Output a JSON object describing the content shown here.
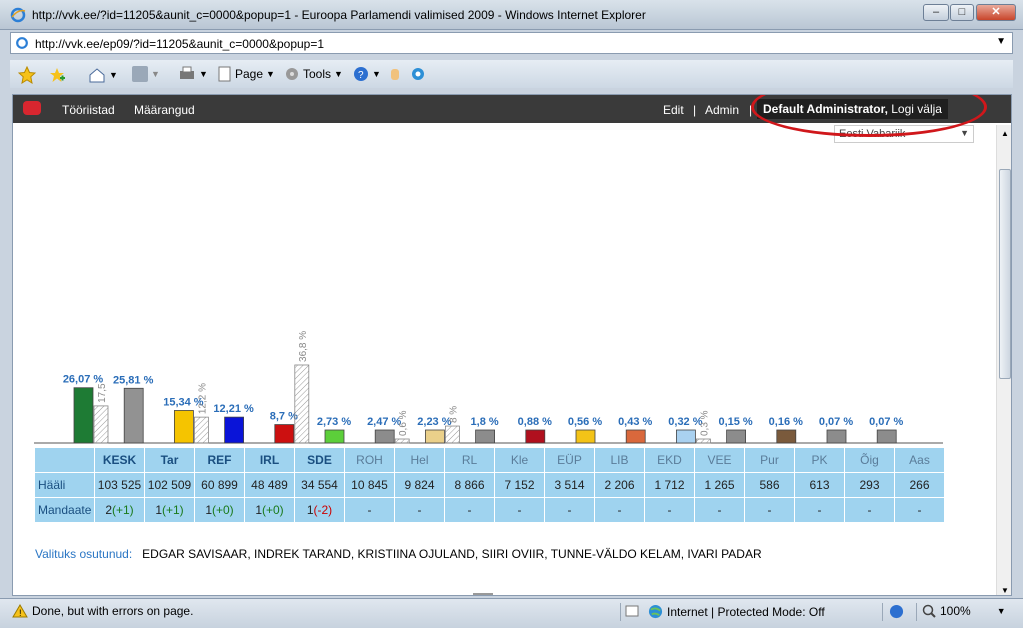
{
  "window": {
    "title": "http://vvk.ee/?id=11205&aunit_c=0000&popup=1 - Euroopa Parlamendi valimised 2009 - Windows Internet Explorer",
    "url": "http://vvk.ee/ep09/?id=11205&aunit_c=0000&popup=1",
    "min": "–",
    "max": "□",
    "close": "✕"
  },
  "commandbar": {
    "page": "Page",
    "tools": "Tools"
  },
  "nav": {
    "tooriistad": "Tööriistad",
    "maarangud": "Määrangud",
    "edit": "Edit",
    "sep": "|",
    "admin": "Admin",
    "user": "Default Administrator,",
    "logout": "Logi välja",
    "select_value": "Eesti Vabariik"
  },
  "chart_data": {
    "type": "bar",
    "categories": [
      "KESK",
      "Tar",
      "REF",
      "IRL",
      "SDE",
      "ROH",
      "Hel",
      "RL",
      "Kle",
      "EÜP",
      "LIB",
      "EKD",
      "VEE",
      "Pur",
      "PK",
      "Õig",
      "Aas"
    ],
    "series": [
      {
        "values": [
          26.07,
          25.81,
          15.34,
          12.21,
          8.7,
          2.73,
          2.47,
          2.23,
          1.8,
          0.88,
          0.56,
          0.43,
          0.32,
          0.15,
          0.16,
          0.07,
          0.07
        ],
        "labels": [
          "26,07 %",
          "25,81 %",
          "15,34 %",
          "12,21 %",
          "8,7 %",
          "2,73 %",
          "2,47 %",
          "2,23 %",
          "1,8 %",
          "0,88 %",
          "0,56 %",
          "0,43 %",
          "0,32 %",
          "0,15 %",
          "0,16 %",
          "0,07 %",
          "0,07 %"
        ]
      },
      {
        "values": [
          17.5,
          null,
          12.2,
          null,
          36.8,
          null,
          0.6,
          8,
          null,
          null,
          null,
          null,
          0.3,
          null,
          null,
          null,
          null
        ],
        "labels": [
          "17,5",
          "",
          "12,2 %",
          "",
          "36,8 %",
          "",
          "0,6 %",
          "8 %",
          "",
          "",
          "",
          "",
          "0,3 %",
          "",
          "",
          "",
          ""
        ]
      }
    ],
    "colors": [
      "#1e7b34",
      "#929292",
      "#f5c400",
      "#0a14d8",
      "#cc1010",
      "#5ccf3a",
      "#8c8c8c",
      "#ead08a",
      "#8c8c8c",
      "#b0101e",
      "#f3c317",
      "#d9683c",
      "#a9d1f0",
      "#8c8c8c",
      "#7a5a3c",
      "#8c8c8c",
      "#8c8c8c"
    ],
    "ylim": [
      0,
      40
    ]
  },
  "table": {
    "row_votes_label": "Hääli",
    "row_seats_label": "Mandaate",
    "headers": [
      "KESK",
      "Tar",
      "REF",
      "IRL",
      "SDE",
      "ROH",
      "Hel",
      "RL",
      "Kle",
      "EÜP",
      "LIB",
      "EKD",
      "VEE",
      "Pur",
      "PK",
      "Õig",
      "Aas"
    ],
    "votes": [
      "103 525",
      "102 509",
      "60 899",
      "48 489",
      "34 554",
      "10 845",
      "9 824",
      "8 866",
      "7 152",
      "3 514",
      "2 206",
      "1 712",
      "1 265",
      "586",
      "613",
      "293",
      "266"
    ],
    "seats_main": [
      "2",
      "1",
      "1",
      "1",
      "1",
      "-",
      "-",
      "-",
      "-",
      "-",
      "-",
      "-",
      "-",
      "-",
      "-",
      "-",
      "-"
    ],
    "seats_change": [
      "(+1)",
      "(+1)",
      "(+0)",
      "(+0)",
      "(-2)",
      "",
      "",
      "",
      "",
      "",
      "",
      "",
      "",
      "",
      "",
      "",
      ""
    ]
  },
  "elected": {
    "label": "Valituks osutunud:",
    "names": "EDGAR SAVISAAR, INDREK TARAND, KRISTIINA OJULAND, SIIRI OVIIR, TUNNE-VÄLDO KELAM, IVARI PADAR"
  },
  "status": {
    "text": "Done, but with errors on page.",
    "zone": "Internet | Protected Mode: Off",
    "zoom": "100%"
  }
}
